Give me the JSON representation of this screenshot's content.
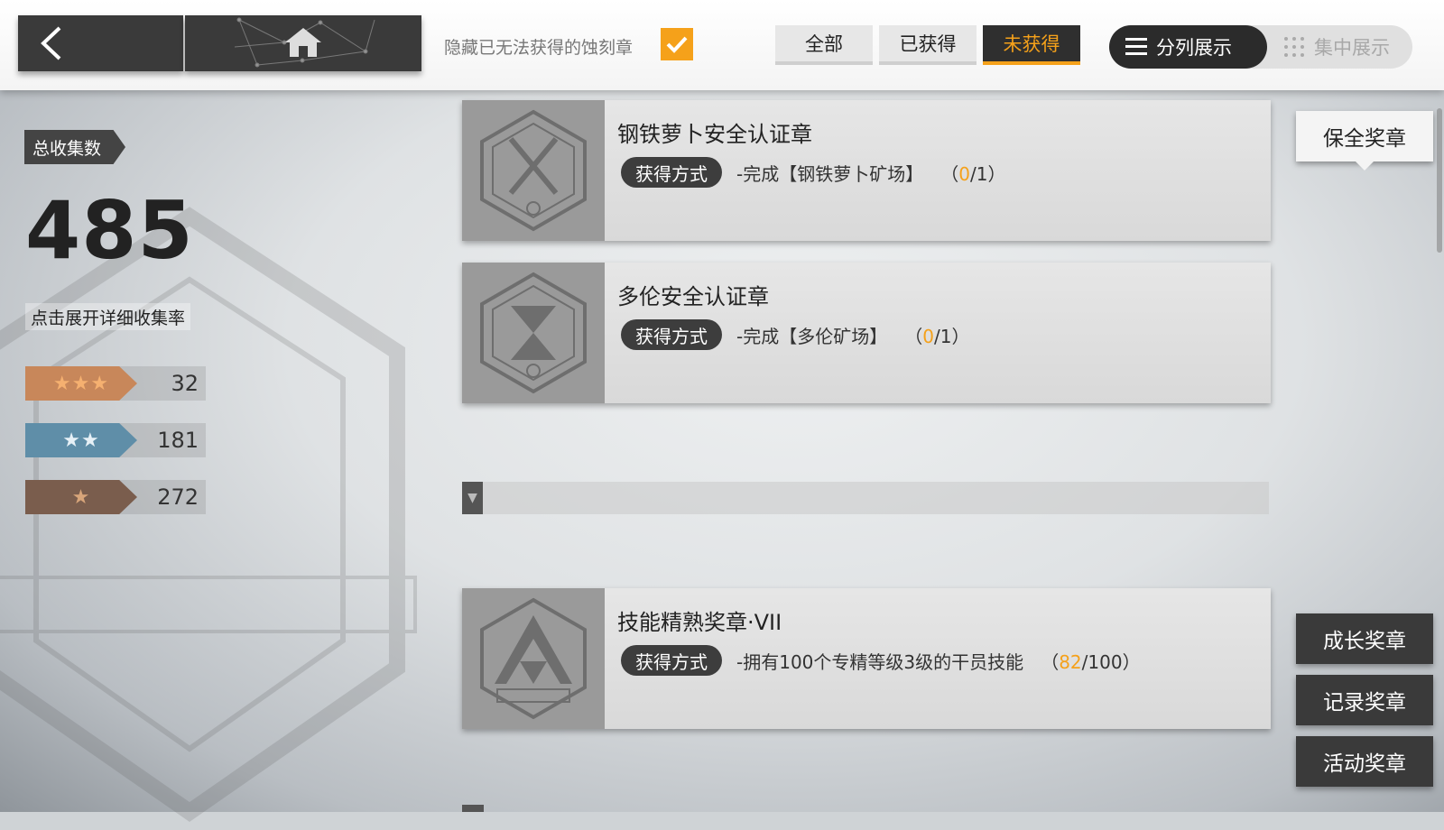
{
  "topbar": {
    "hide_label": "隐藏已无法获得的蚀刻章",
    "hide_checked": true,
    "filters": [
      "全部",
      "已获得",
      "未获得"
    ],
    "active_filter": "未获得",
    "view_modes": [
      "分列展示",
      "集中展示"
    ],
    "active_view": "分列展示"
  },
  "summary": {
    "total_label": "总收集数",
    "total": "485",
    "expand_label": "点击展开详细收集率",
    "rarities": [
      {
        "stars": "★★★",
        "count": "32",
        "color": "#c8875a"
      },
      {
        "stars": "★★",
        "count": "181",
        "color": "#5f8ea8"
      },
      {
        "stars": "★",
        "count": "272",
        "color": "#7a5d4d"
      }
    ]
  },
  "medals": [
    {
      "name": "钢铁萝卜安全认证章",
      "obtain_label": "获得方式",
      "desc_prefix": "-完成【钢铁萝卜矿场】",
      "progress_open": "（",
      "current": "0",
      "progress_close": "/1）",
      "icon": "safety-certificate-icon"
    },
    {
      "name": "多伦安全认证章",
      "obtain_label": "获得方式",
      "desc_prefix": "-完成【多伦矿场】",
      "progress_open": "（",
      "current": "0",
      "progress_close": "/1）",
      "icon": "safety-certificate-icon"
    },
    {
      "name": "技能精熟奖章·VII",
      "obtain_label": "获得方式",
      "desc_prefix": "-拥有100个专精等级3级的干员技能",
      "progress_open": "（",
      "current": "82",
      "progress_close": "/100）",
      "icon": "advanced-training-icon"
    }
  ],
  "categories": [
    {
      "label": "保全奖章",
      "active": true
    },
    {
      "label": "成长奖章",
      "active": false
    },
    {
      "label": "记录奖章",
      "active": false
    },
    {
      "label": "活动奖章",
      "active": false
    }
  ],
  "colors": {
    "accent": "#f5a11a",
    "dark": "#3a3a3a"
  }
}
